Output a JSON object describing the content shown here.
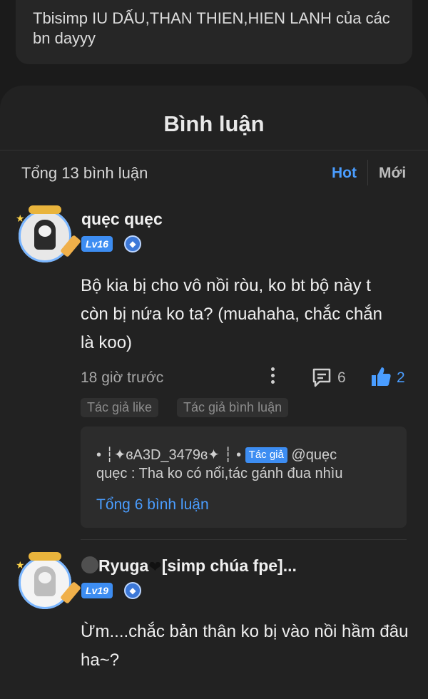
{
  "top_post": {
    "text": "Tbisimp IU DẤU,THAN THIEN,HIEN LANH của các bn dayyy"
  },
  "comments_panel": {
    "title": "Bình luận",
    "total": "Tổng 13 bình luận",
    "sort": {
      "hot": "Hot",
      "new": "Mới"
    }
  },
  "comments": [
    {
      "username": "quẹc quẹc",
      "level": "Lv16",
      "text": "Bộ kia bị cho vô nồi ròu, ko bt bộ này t còn bị nứa ko ta? (muahaha, chắc chắn là koo)",
      "time": "18 giờ trước",
      "reply_count": "6",
      "like_count": "2",
      "tags": [
        "Tác giả like",
        "Tác giả bình luận"
      ],
      "reply": {
        "author": "• ┆✦ɞA3D_3479ɞ✦ ┆ •",
        "author_tag": "Tác giả",
        "mention": "@quẹc",
        "continuation": "quẹc : Tha ko có nổi,tác gánh đua nhìu",
        "total": "Tổng 6 bình luận"
      }
    },
    {
      "username_pre": "",
      "username": "Ryuga",
      "username_post": "[simp chúa fpe]...",
      "level": "Lv19",
      "text": "Ừm....chắc bản thân ko bị vào nồi hầm đâu ha~?"
    }
  ],
  "colors": {
    "accent": "#4a9dff",
    "background": "#1b1b1b",
    "panel": "#222222"
  }
}
